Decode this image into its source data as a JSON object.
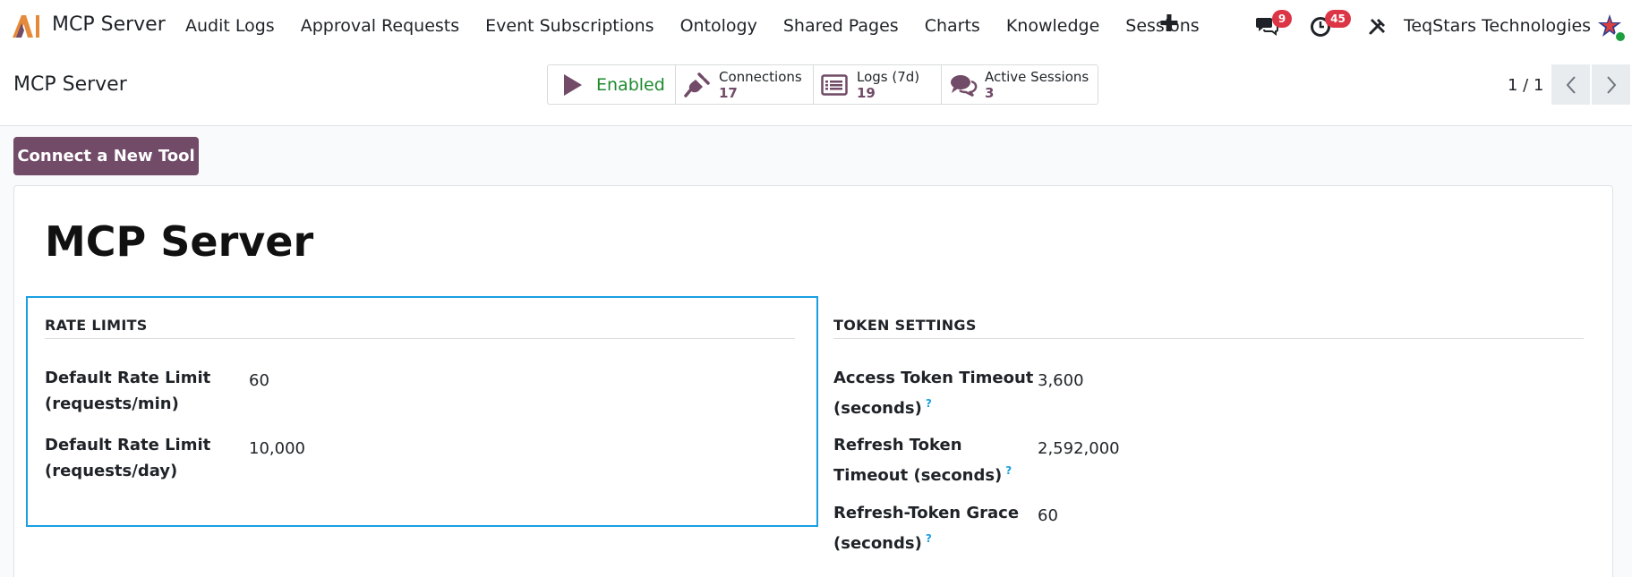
{
  "navbar": {
    "app_name": "MCP Server",
    "menu": [
      "Audit Logs",
      "Approval Requests",
      "Event Subscriptions",
      "Ontology",
      "Shared Pages",
      "Charts",
      "Knowledge",
      "Sessions"
    ],
    "messages_count": "9",
    "activities_count": "45",
    "company": "TeqStars Technologies",
    "icons": {
      "logo": "ai-logo-icon",
      "add": "plus-icon",
      "messages": "chat-bubbles-icon",
      "activities": "clock-icon",
      "debug": "tools-icon",
      "avatar": "star-avatar-icon"
    }
  },
  "control": {
    "title": "MCP Server",
    "smart_buttons": {
      "enabled_label": "Enabled",
      "connections_label": "Connections",
      "connections_value": "17",
      "logs_label": "Logs (7d)",
      "logs_value": "19",
      "sessions_label": "Active Sessions",
      "sessions_value": "3"
    },
    "pager": "1 / 1"
  },
  "actions": {
    "connect_tool": "Connect a New Tool"
  },
  "form": {
    "title": "MCP Server",
    "rate_limits": {
      "heading": "RATE LIMITS",
      "fields": [
        {
          "label_line1": "Default Rate Limit",
          "label_line2": "(requests/min)",
          "value": "60"
        },
        {
          "label_line1": "Default Rate Limit",
          "label_line2": "(requests/day)",
          "value": "10,000"
        }
      ]
    },
    "token_settings": {
      "heading": "TOKEN SETTINGS",
      "fields": [
        {
          "label_line1": "Access Token Timeout",
          "label_line2": "(seconds)",
          "value": "3,600"
        },
        {
          "label_line1": "Refresh Token",
          "label_line2": "Timeout (seconds)",
          "value": "2,592,000"
        },
        {
          "label_line1": "Refresh-Token Grace",
          "label_line2": "(seconds)",
          "value": "60"
        }
      ]
    },
    "help_mark": "?"
  },
  "colors": {
    "brand": "#714b67",
    "focus": "#1a9fe2",
    "enabled": "#1e8a2e",
    "badge": "#dc3545"
  }
}
